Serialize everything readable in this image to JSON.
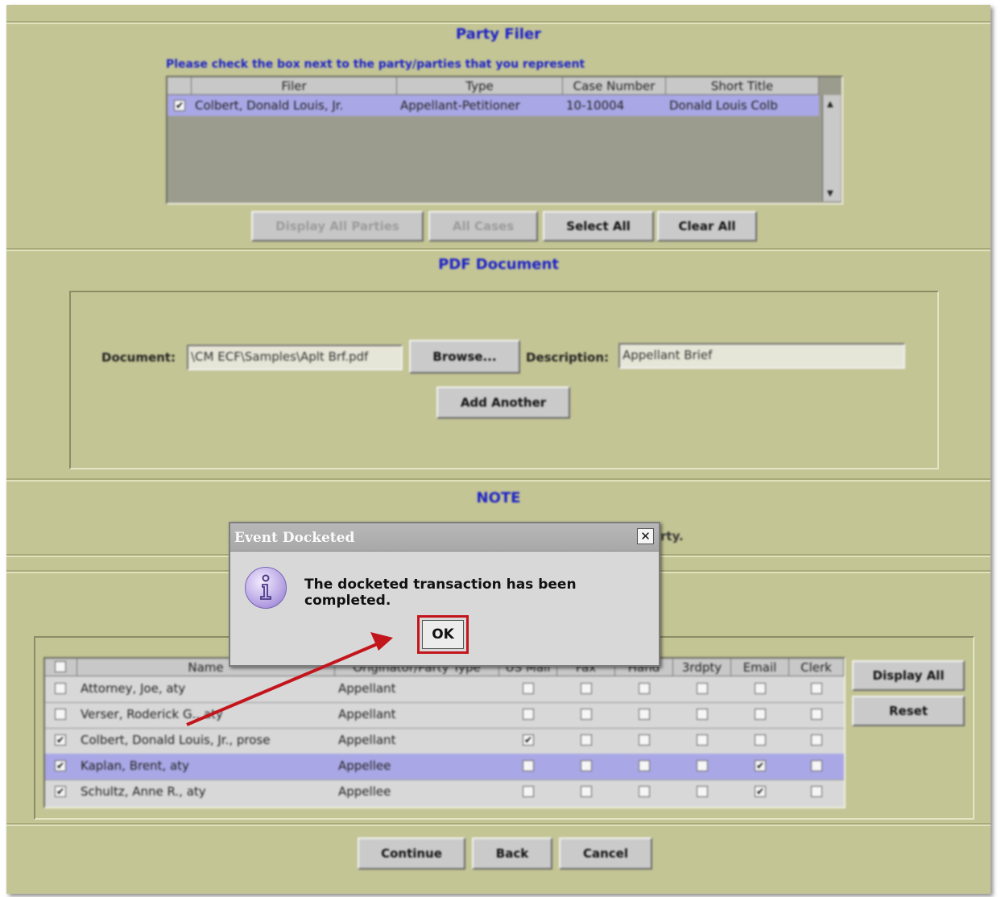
{
  "party_filer": {
    "title": "Party Filer",
    "instruction": "Please check the box next to the party/parties that you represent",
    "columns": [
      "",
      "Filer",
      "Type",
      "Case Number",
      "Short Title"
    ],
    "rows": [
      {
        "checked": "✔",
        "filer": "Colbert, Donald Louis, Jr.",
        "type": "Appellant-Petitioner",
        "case_number": "10-10004",
        "short_title": "Donald Louis Colb"
      }
    ],
    "buttons": {
      "display_all_parties": "Display All Parties",
      "all_cases": "All Cases",
      "select_all": "Select All",
      "clear_all": "Clear All"
    }
  },
  "pdf_document": {
    "title": "PDF Document",
    "document_label": "Document:",
    "document_value": "\\CM ECF\\Samples\\Aplt Brf.pdf",
    "browse_label": "Browse...",
    "description_label": "Description:",
    "description_value": "Appellant Brief",
    "add_another_label": "Add Another"
  },
  "note": {
    "title": "NOTE",
    "text_fragment": "rty."
  },
  "service": {
    "columns": [
      "",
      "Name",
      "Originator/Party Type",
      "US Mail",
      "Fax",
      "Hand",
      "3rdpty",
      "Email",
      "Clerk"
    ],
    "rows": [
      {
        "checked": "",
        "name": "Attorney, Joe, aty",
        "party_type": "Appellant",
        "us_mail": "",
        "fax": "",
        "hand": "",
        "third": "",
        "email": "",
        "clerk": ""
      },
      {
        "checked": "",
        "name": "Verser, Roderick G., aty",
        "party_type": "Appellant",
        "us_mail": "",
        "fax": "",
        "hand": "",
        "third": "",
        "email": "",
        "clerk": ""
      },
      {
        "checked": "✔",
        "name": "Colbert, Donald Louis, Jr., prose",
        "party_type": "Appellant",
        "us_mail": "✔",
        "fax": "",
        "hand": "",
        "third": "",
        "email": "",
        "clerk": ""
      },
      {
        "checked": "✔",
        "name": "Kaplan, Brent, aty",
        "party_type": "Appellee",
        "us_mail": "",
        "fax": "",
        "hand": "",
        "third": "",
        "email": "✔",
        "clerk": ""
      },
      {
        "checked": "✔",
        "name": "Schultz, Anne R., aty",
        "party_type": "Appellee",
        "us_mail": "",
        "fax": "",
        "hand": "",
        "third": "",
        "email": "✔",
        "clerk": ""
      }
    ],
    "buttons": {
      "display_all": "Display All",
      "reset": "Reset"
    }
  },
  "footer_buttons": {
    "continue": "Continue",
    "back": "Back",
    "cancel": "Cancel"
  },
  "dialog": {
    "title": "Event Docketed",
    "close": "✕",
    "message": "The docketed transaction has been completed.",
    "ok": "OK"
  },
  "colors": {
    "panel": "#c4c595",
    "title_blue": "#1c22c8",
    "highlight": "#c3161c",
    "selection": "#a8a6e8"
  }
}
